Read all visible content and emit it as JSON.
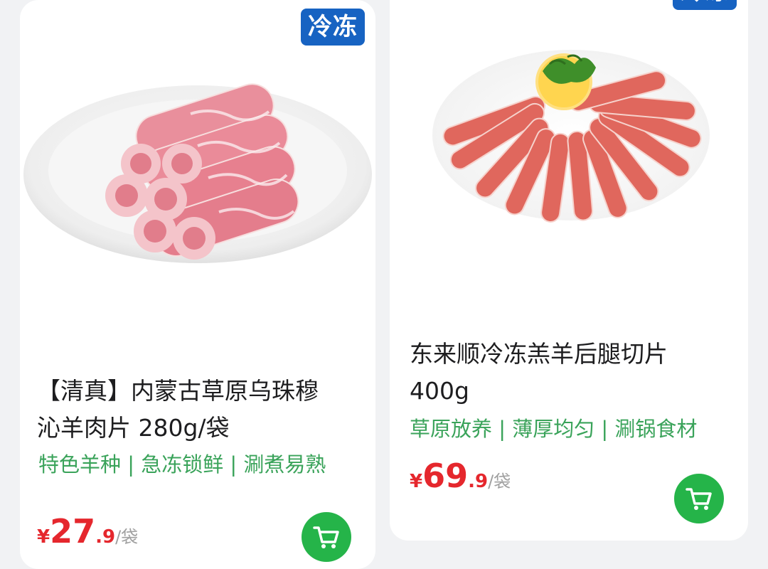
{
  "products": [
    {
      "badge": "冷冻",
      "title_line1": "【清真】内蒙古草原乌珠穆",
      "title_line2": "沁羊肉片 280g/袋",
      "tags": "特色羊种 | 急冻锁鲜 | 涮煮易熟",
      "price": {
        "currency": "¥",
        "integer": "27",
        "decimal": ".9",
        "unit": "/袋"
      },
      "image_icon": "lamb-rolls-on-plate-image",
      "cart_icon": "cart-icon"
    },
    {
      "badge": "冷冻",
      "title_line1": "东来顺冷冻羔羊后腿切片",
      "title_line2": "400g",
      "tags": "草原放养 | 薄厚均匀 | 涮锅食材",
      "price": {
        "currency": "¥",
        "integer": "69",
        "decimal": ".9",
        "unit": "/袋"
      },
      "image_icon": "lamb-slices-fan-plate-image",
      "cart_icon": "cart-icon"
    }
  ],
  "colors": {
    "badge": "#1763c2",
    "tag_green": "#3aa35a",
    "price_red": "#e5272d",
    "cart_green": "#25b449"
  }
}
